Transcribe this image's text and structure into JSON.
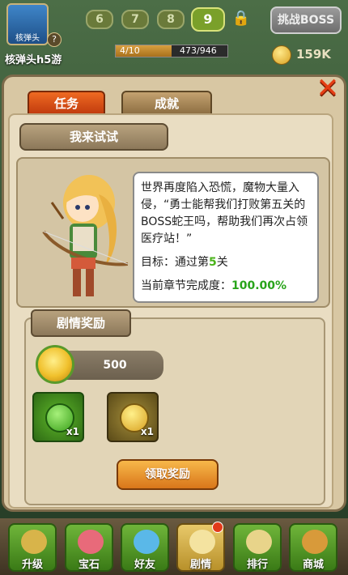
{
  "hud": {
    "avatar_label": "核弹头",
    "help_icon": "?",
    "player_name": "核弹头h5游",
    "levels": [
      "6",
      "7",
      "8",
      "9"
    ],
    "active_level_index": 3,
    "boss_button": "挑战BOSS",
    "progress_left": "4/10",
    "progress_right": "473/946",
    "progress_fraction": 0.5,
    "gold": "159K"
  },
  "panel": {
    "tab_active": "任务",
    "tab_inactive": "成就",
    "close_icon": "✕",
    "section_title": "我来试试",
    "story": "世界再度陷入恐慌，魔物大量入侵，“勇士能帮我们打败第五关的BOSS蛇王吗，帮助我们再次占领医疗站！”",
    "goal_prefix": "目标：通过第",
    "goal_num": "5",
    "goal_suffix": "关",
    "rate_label": "当前章节完成度：",
    "rate_value": "100.00%",
    "reward_title": "剧情奖励",
    "coin_reward": "500",
    "items": [
      {
        "icon": "green-potion-icon",
        "qty": "x1"
      },
      {
        "icon": "gold-coin-icon",
        "qty": "x1"
      }
    ],
    "claim_button": "领取奖励"
  },
  "nav": [
    {
      "label": "升级",
      "icon": "upgrade-icon",
      "gold": false
    },
    {
      "label": "宝石",
      "icon": "gem-icon",
      "gold": false
    },
    {
      "label": "好友",
      "icon": "friends-icon",
      "gold": false
    },
    {
      "label": "剧情",
      "icon": "story-icon",
      "gold": true,
      "notify": true
    },
    {
      "label": "排行",
      "icon": "ranking-icon",
      "gold": false
    },
    {
      "label": "商城",
      "icon": "shop-icon",
      "gold": false
    }
  ],
  "colors": {
    "accent": "#e85a1c",
    "success": "#28a41a"
  }
}
